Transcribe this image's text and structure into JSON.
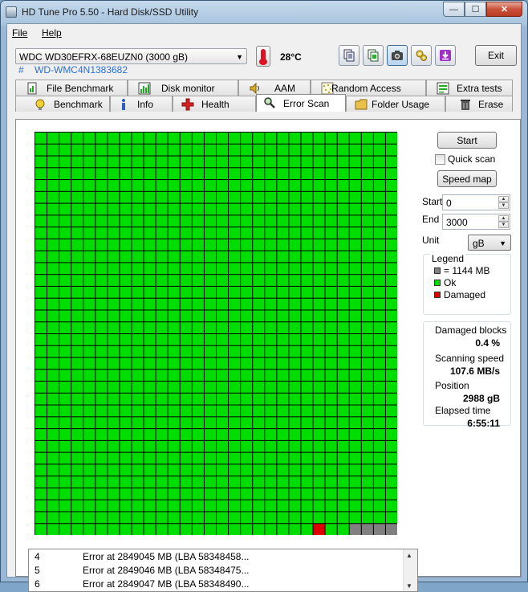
{
  "window": {
    "title": "HD Tune Pro 5.50 - Hard Disk/SSD Utility",
    "minimize": "—",
    "maximize": "☐",
    "close": "✕"
  },
  "menu": {
    "file": "File",
    "help": "Help"
  },
  "toolbar": {
    "drive": "WDC WD30EFRX-68EUZN0 (3000 gB)",
    "temperature": "28°C",
    "exit_label": "Exit",
    "serial_hash": "#",
    "serial": "WD-WMC4N1383682",
    "icons": [
      "copy-info-icon",
      "copy-text-icon",
      "screenshot-camera-icon",
      "settings-icon",
      "save-download-icon"
    ]
  },
  "tabs": {
    "top": [
      {
        "label": "File Benchmark",
        "icon": "file-benchmark-icon"
      },
      {
        "label": "Disk monitor",
        "icon": "disk-monitor-icon"
      },
      {
        "label": "AAM",
        "icon": "speaker-icon"
      },
      {
        "label": "Random Access",
        "icon": "random-access-icon"
      },
      {
        "label": "Extra tests",
        "icon": "extra-tests-icon"
      }
    ],
    "bottom": [
      {
        "label": "Benchmark",
        "icon": "benchmark-icon"
      },
      {
        "label": "Info",
        "icon": "info-icon"
      },
      {
        "label": "Health",
        "icon": "health-cross-icon"
      },
      {
        "label": "Error Scan",
        "icon": "magnifier-icon",
        "active": true
      },
      {
        "label": "Folder Usage",
        "icon": "folder-icon"
      },
      {
        "label": "Erase",
        "icon": "trash-icon"
      }
    ]
  },
  "error_scan": {
    "start_button": "Start",
    "quick_scan_label": "Quick scan",
    "quick_scan_checked": false,
    "speed_map_button": "Speed map",
    "start_label": "Start",
    "start_value": "0",
    "end_label": "End",
    "end_value": "3000",
    "unit_label": "Unit",
    "unit_value": "gB",
    "legend": {
      "title": "Legend",
      "block_size": "= 1144 MB",
      "ok": "Ok",
      "damaged": "Damaged"
    },
    "stats": {
      "damaged_blocks_label": "Damaged blocks",
      "damaged_blocks_value": "0.4 %",
      "scanning_speed_label": "Scanning speed",
      "scanning_speed_value": "107.6 MB/s",
      "position_label": "Position",
      "position_value": "2988 gB",
      "elapsed_label": "Elapsed time",
      "elapsed_value": "6:55:11"
    },
    "grid": {
      "columns": 30,
      "rows": 34,
      "ok_color": "#00dd00",
      "damaged_color": "#e00000",
      "unscanned_color": "#808080",
      "damaged_block_index": 1013,
      "unscanned_from_index": 1016
    },
    "log": [
      {
        "n": "4",
        "text": "Error at 2849045 MB (LBA 58348458..."
      },
      {
        "n": "5",
        "text": "Error at 2849046 MB (LBA 58348475..."
      },
      {
        "n": "6",
        "text": "Error at 2849047 MB (LBA 58348490..."
      }
    ]
  }
}
